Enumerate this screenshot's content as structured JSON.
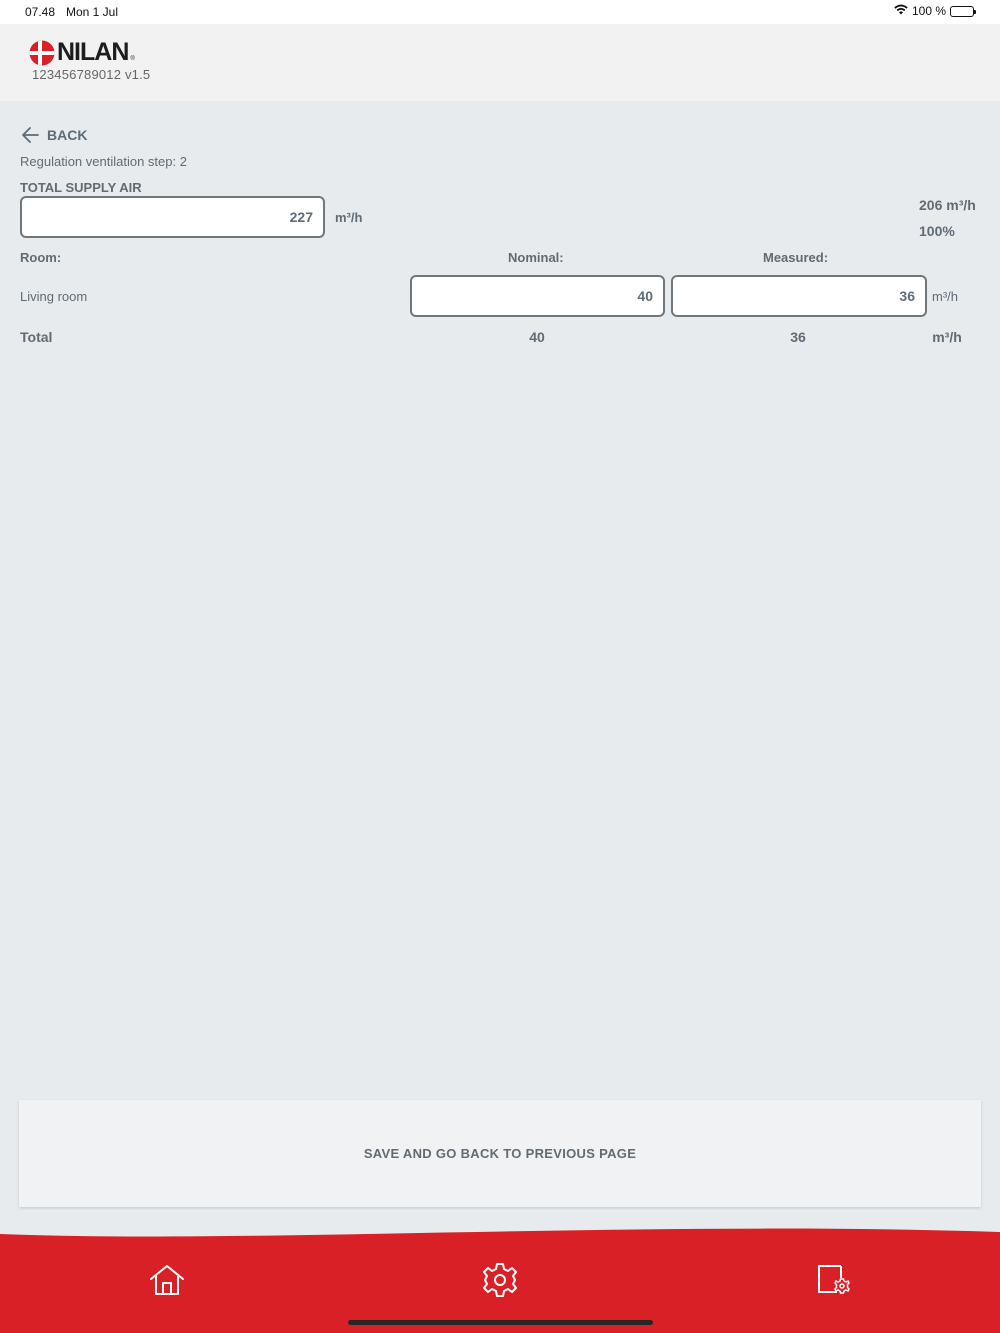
{
  "status_bar": {
    "time": "07.48",
    "date": "Mon 1 Jul",
    "battery": "100 %"
  },
  "header": {
    "logo_text": "NILAN",
    "logo_reg": "®",
    "device_id": "123456789012 v1.5"
  },
  "nav": {
    "back_label": "BACK"
  },
  "page": {
    "subtitle": "Regulation ventilation step: 2",
    "section_title": "TOTAL SUPPLY AIR",
    "total_supply_value": "227",
    "total_supply_unit": "m³/h",
    "target_flow": "206 m³/h",
    "target_percent": "100%"
  },
  "table": {
    "headers": {
      "room": "Room:",
      "nominal": "Nominal:",
      "measured": "Measured:"
    },
    "rows": [
      {
        "room": "Living room",
        "nominal": "40",
        "measured": "36",
        "unit": "m³/h"
      }
    ],
    "total": {
      "label": "Total",
      "nominal": "40",
      "measured": "36",
      "unit": "m³/h"
    }
  },
  "save_button": {
    "label": "SAVE AND GO BACK TO PREVIOUS PAGE"
  },
  "colors": {
    "brand_red": "#d92027",
    "text": "#5f6b75",
    "background": "#e8ebee"
  },
  "bottom_nav": [
    "home-icon",
    "settings-gear-icon",
    "device-settings-icon"
  ]
}
